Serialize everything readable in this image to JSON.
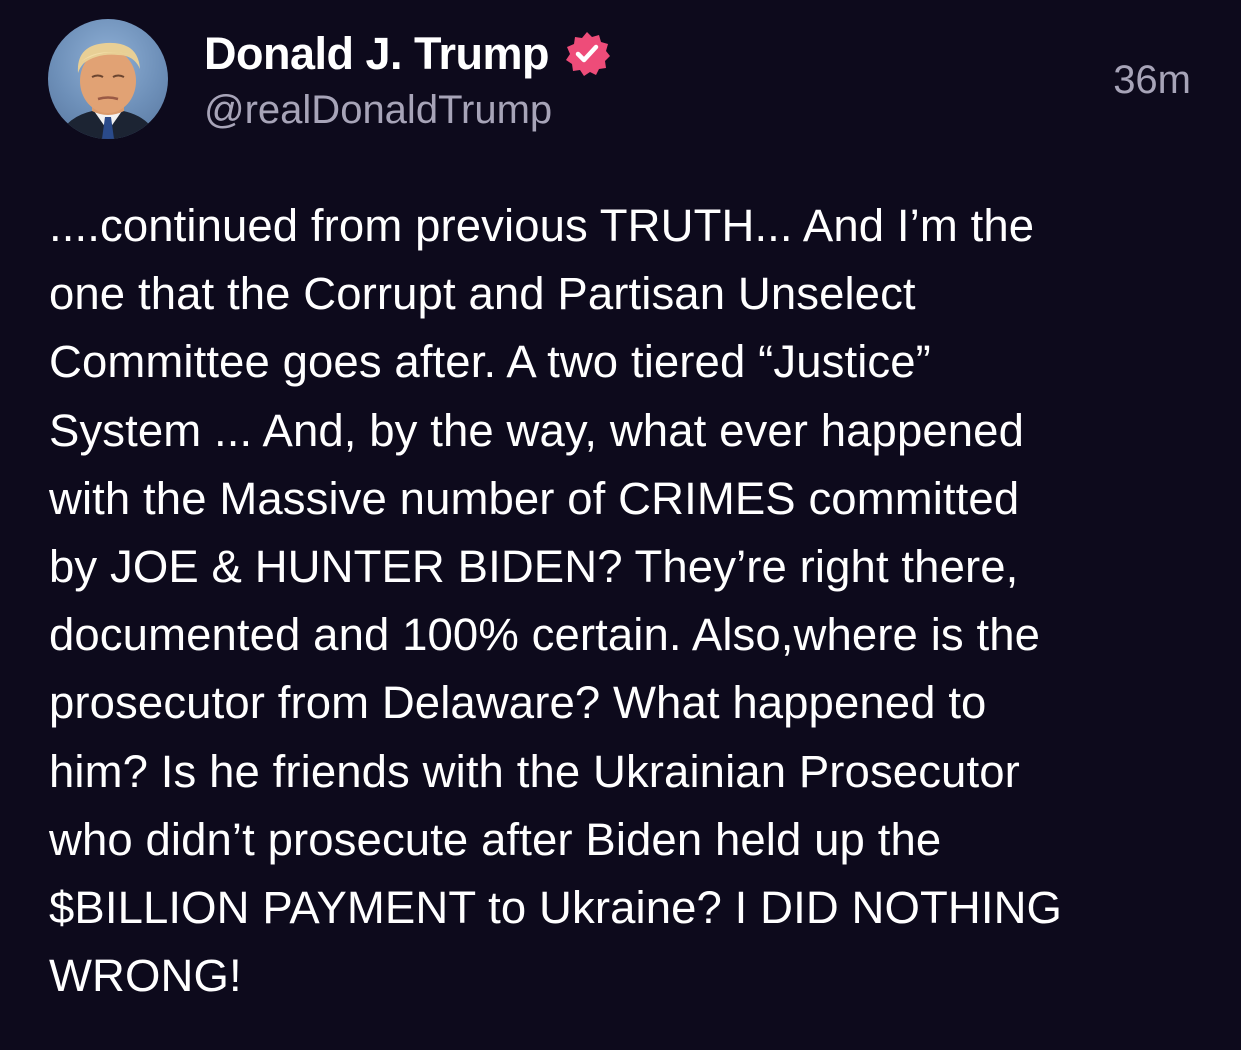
{
  "post": {
    "author": {
      "display_name": "Donald J. Trump",
      "handle": "@realDonaldTrump",
      "verified": true,
      "verified_badge_color": "#ee4c79",
      "avatar_icon": "profile-photo"
    },
    "timestamp": "36m",
    "body": "....continued from previous TRUTH... And I’m the\none that the Corrupt and Partisan Unselect\nCommittee goes after. A two tiered “Justice”\nSystem ... And, by the way, what ever happened\nwith the Massive number of CRIMES committed\nby JOE & HUNTER BIDEN? They’re right there,\ndocumented and 100% certain. Also,where is the\nprosecutor from Delaware? What happened to\nhim? Is he friends with the Ukrainian Prosecutor\nwho didn’t prosecute after Biden held up the\n$BILLION PAYMENT to Ukraine? I DID NOTHING\nWRONG!"
  },
  "theme": {
    "background": "#0d0a1c",
    "text": "#ffffff",
    "muted_text": "#a7a4b8"
  }
}
